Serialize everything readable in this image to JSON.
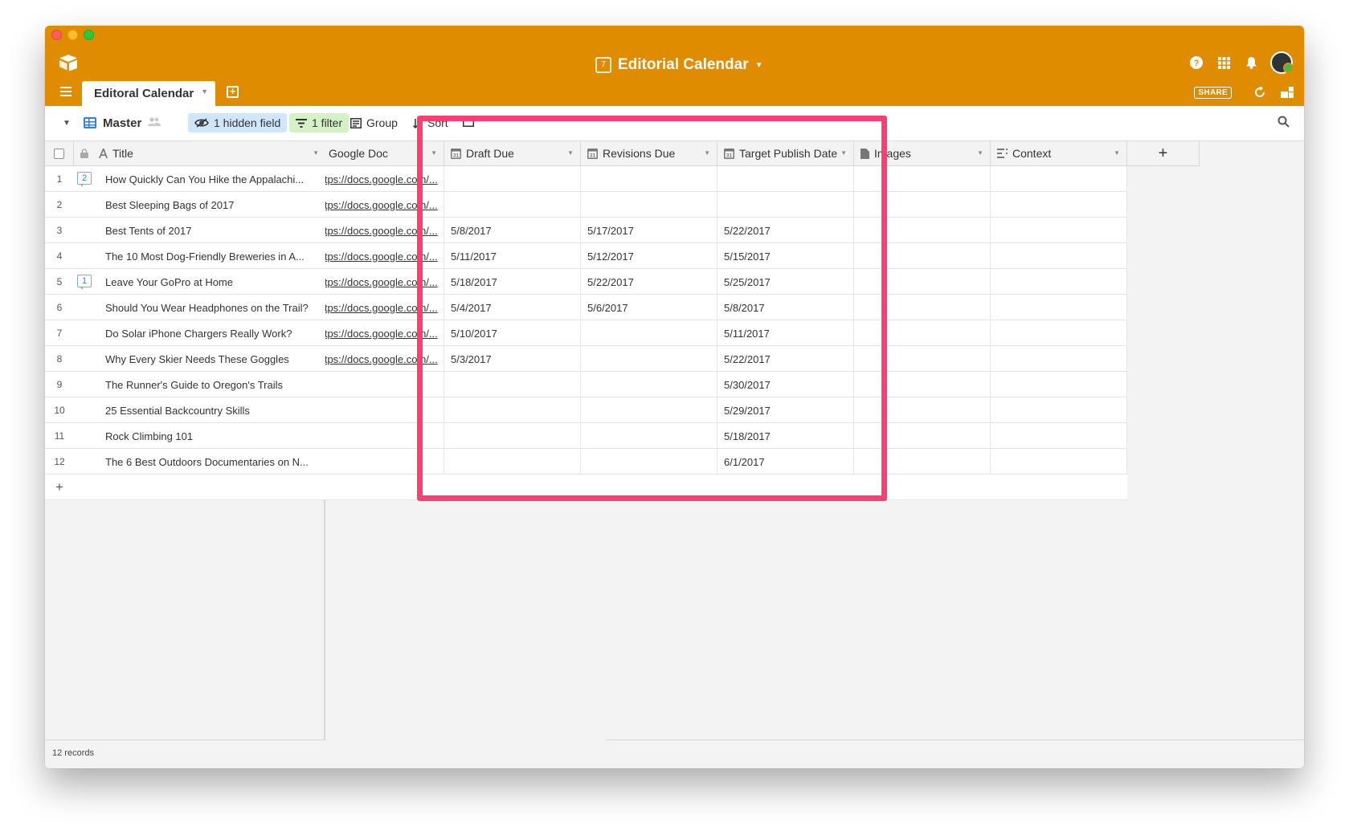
{
  "window": {
    "title": "Editorial Calendar",
    "calendar_day": "7"
  },
  "tabs": {
    "active": "Editoral Calendar"
  },
  "top_right": {
    "share_label": "SHARE"
  },
  "view": {
    "name": "Master",
    "hidden_fields": "1 hidden field",
    "filter": "1 filter",
    "group": "Group",
    "sort": "Sort"
  },
  "columns": {
    "title": "Title",
    "google_doc": "Google Doc",
    "draft_due": "Draft Due",
    "revisions_due": "Revisions Due",
    "target_publish": "Target Publish Date",
    "images": "Images",
    "context": "Context",
    "add": "+"
  },
  "records": [
    {
      "num": "1",
      "title": "How Quickly Can You Hike the Appalachi...",
      "comments": "2",
      "doc": "https://docs.google.com/...",
      "draft": "",
      "revisions": "",
      "publish": ""
    },
    {
      "num": "2",
      "title": "Best Sleeping Bags of 2017",
      "comments": "",
      "doc": "https://docs.google.com/...",
      "draft": "",
      "revisions": "",
      "publish": ""
    },
    {
      "num": "3",
      "title": "Best Tents of 2017",
      "comments": "",
      "doc": "https://docs.google.com/...",
      "draft": "5/8/2017",
      "revisions": "5/17/2017",
      "publish": "5/22/2017"
    },
    {
      "num": "4",
      "title": "The 10 Most Dog-Friendly Breweries in A...",
      "comments": "",
      "doc": "https://docs.google.com/...",
      "draft": "5/11/2017",
      "revisions": "5/12/2017",
      "publish": "5/15/2017"
    },
    {
      "num": "5",
      "title": "Leave Your GoPro at Home",
      "comments": "1",
      "doc": "https://docs.google.com/...",
      "draft": "5/18/2017",
      "revisions": "5/22/2017",
      "publish": "5/25/2017"
    },
    {
      "num": "6",
      "title": "Should You Wear Headphones on the Trail?",
      "comments": "",
      "doc": "https://docs.google.com/...",
      "draft": "5/4/2017",
      "revisions": "5/6/2017",
      "publish": "5/8/2017"
    },
    {
      "num": "7",
      "title": "Do Solar iPhone Chargers Really Work?",
      "comments": "",
      "doc": "https://docs.google.com/...",
      "draft": "5/10/2017",
      "revisions": "",
      "publish": "5/11/2017"
    },
    {
      "num": "8",
      "title": "Why Every Skier Needs These Goggles",
      "comments": "",
      "doc": "https://docs.google.com/...",
      "draft": "5/3/2017",
      "revisions": "",
      "publish": "5/22/2017"
    },
    {
      "num": "9",
      "title": "The Runner's Guide to Oregon's Trails",
      "comments": "",
      "doc": "",
      "draft": "",
      "revisions": "",
      "publish": "5/30/2017"
    },
    {
      "num": "10",
      "title": "25 Essential Backcountry Skills",
      "comments": "",
      "doc": "",
      "draft": "",
      "revisions": "",
      "publish": "5/29/2017"
    },
    {
      "num": "11",
      "title": "Rock Climbing 101",
      "comments": "",
      "doc": "",
      "draft": "",
      "revisions": "",
      "publish": "5/18/2017"
    },
    {
      "num": "12",
      "title": "The 6 Best Outdoors Documentaries on N...",
      "comments": "",
      "doc": "",
      "draft": "",
      "revisions": "",
      "publish": "6/1/2017"
    }
  ],
  "add_row": "+",
  "footer": {
    "record_count": "12 records"
  },
  "colors": {
    "brand": "#e08c00",
    "highlight": "#fb3f72",
    "link_blue": "#2d7ff9"
  }
}
